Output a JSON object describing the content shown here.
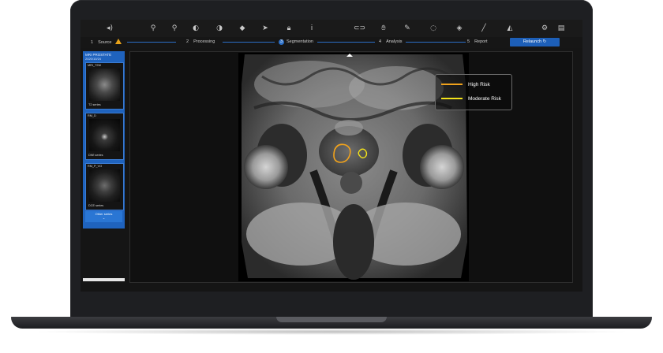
{
  "toolbar": {
    "icons": [
      "speaker-icon",
      "zoom-icon",
      "zoom-in-icon",
      "contrast-icon",
      "window-level-icon",
      "measure-icon",
      "pointer-icon",
      "lock-icon",
      "info-icon",
      "toggle-icon",
      "hand-icon",
      "edit-icon",
      "circle-icon",
      "tag-icon",
      "brush-icon",
      "eraser-icon",
      "settings-icon",
      "document-icon"
    ]
  },
  "stepper": {
    "steps": [
      {
        "num": "1",
        "label": "Source"
      },
      {
        "num": "2",
        "label": "Processing"
      },
      {
        "num": "3",
        "label": "Segmentation"
      },
      {
        "num": "4",
        "label": "Analysis"
      },
      {
        "num": "5",
        "label": "Report"
      }
    ],
    "active": 2,
    "warning_on_step": 0,
    "relaunch_label": "Relaunch ↻"
  },
  "sidebar": {
    "study_title": "MRI PROSTATE",
    "study_date": "2020/10/24",
    "series": [
      {
        "top": "MRI_T2W",
        "label": "T2 series"
      },
      {
        "top": "RM_D",
        "label": "DWI series"
      },
      {
        "top": "RM_P_VO",
        "label": "DCE series"
      }
    ],
    "other_series": "Other series",
    "other_series_chevron": "⌄"
  },
  "legend": {
    "items": [
      {
        "label": "High Risk",
        "color": "#f0a21c"
      },
      {
        "label": "Moderate Risk",
        "color": "#f2e21a"
      }
    ]
  },
  "colors": {
    "accent": "#1f63be",
    "warning": "#e8a21a",
    "high_risk": "#f0a21c",
    "moderate_risk": "#f2e21a"
  }
}
